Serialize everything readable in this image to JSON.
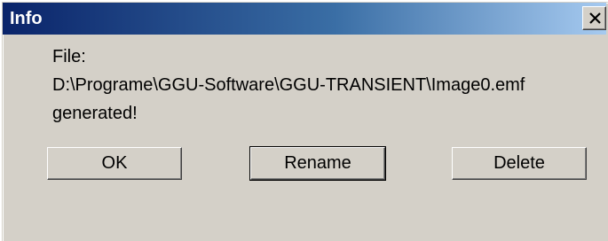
{
  "window": {
    "title": "Info",
    "close_icon": "close-x-icon"
  },
  "message": {
    "line1": "File:",
    "line2": "D:\\Programe\\GGU-Software\\GGU-TRANSIENT\\Image0.emf",
    "line3": "generated!"
  },
  "buttons": {
    "ok": "OK",
    "rename": "Rename",
    "delete": "Delete"
  },
  "colors": {
    "titlebar_start": "#0a246a",
    "titlebar_end": "#a6caf0",
    "dialog_bg": "#d4d0c8"
  }
}
